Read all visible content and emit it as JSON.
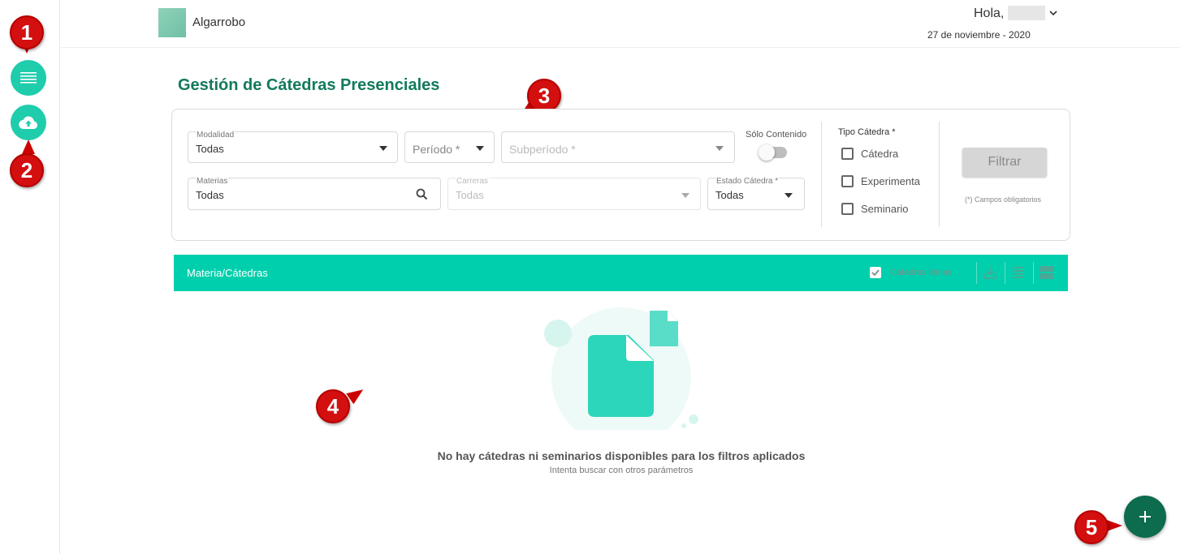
{
  "header": {
    "org_name": "Algarrobo",
    "greeting": "Hola,",
    "date": "27 de noviembre - 2020"
  },
  "page": {
    "title": "Gestión de Cátedras Presenciales"
  },
  "filters": {
    "modalidad": {
      "label": "Modalidad",
      "value": "Todas"
    },
    "periodo": {
      "placeholder": "Período *"
    },
    "subperiodo": {
      "placeholder": "Subperíodo *"
    },
    "solo_contenido": {
      "label": "Sólo Contenido"
    },
    "materias": {
      "label": "Materias",
      "value": "Todas"
    },
    "carreras": {
      "label": "Carreras",
      "value": "Todas"
    },
    "estado_catedra": {
      "label": "Estado Cátedra *",
      "value": "Todas"
    },
    "tipo_catedra": {
      "title": "Tipo Cátedra *",
      "options": [
        "Cátedra",
        "Experimenta",
        "Seminario"
      ]
    },
    "filter_button": "Filtrar",
    "required_note": "(*) Campos obligatorios"
  },
  "results_bar": {
    "title": "Materia/Cátedras",
    "checkbox_label": "Cátedras llenas"
  },
  "empty_state": {
    "message": "No hay cátedras ni seminarios disponibles para los filtros aplicados",
    "hint": "Intenta buscar con otros parámetros"
  },
  "callouts": [
    "1",
    "2",
    "3",
    "4",
    "5"
  ],
  "colors": {
    "accent": "#00cfad",
    "title_green": "#127a5c",
    "fab": "#0d6b4e",
    "callout_red": "#d30f0f"
  },
  "icons": {
    "rail_1": "list-icon",
    "rail_2": "cloud-upload-icon",
    "materias": "search-icon",
    "bar": [
      "download-icon",
      "list-view-icon",
      "card-view-icon"
    ],
    "fab": "plus-icon"
  }
}
